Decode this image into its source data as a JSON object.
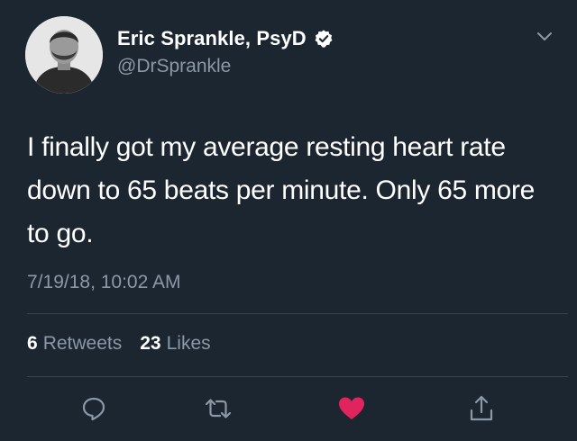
{
  "user": {
    "display_name": "Eric Sprankle, PsyD",
    "handle": "@DrSprankle",
    "verified": true
  },
  "tweet": {
    "text": "I finally got my average resting heart rate down to 65 beats per minute. Only 65 more to go.",
    "timestamp": "7/19/18, 10:02 AM"
  },
  "stats": {
    "retweets_count": "6",
    "retweets_label": "Retweets",
    "likes_count": "23",
    "likes_label": "Likes"
  },
  "actions": {
    "reply_icon": "reply-icon",
    "retweet_icon": "retweet-icon",
    "like_icon": "heart-icon",
    "share_icon": "share-icon"
  },
  "colors": {
    "background": "#1c2631",
    "secondary_text": "#8b98a5",
    "like_active": "#e0245e",
    "icon": "#8b98a5"
  }
}
